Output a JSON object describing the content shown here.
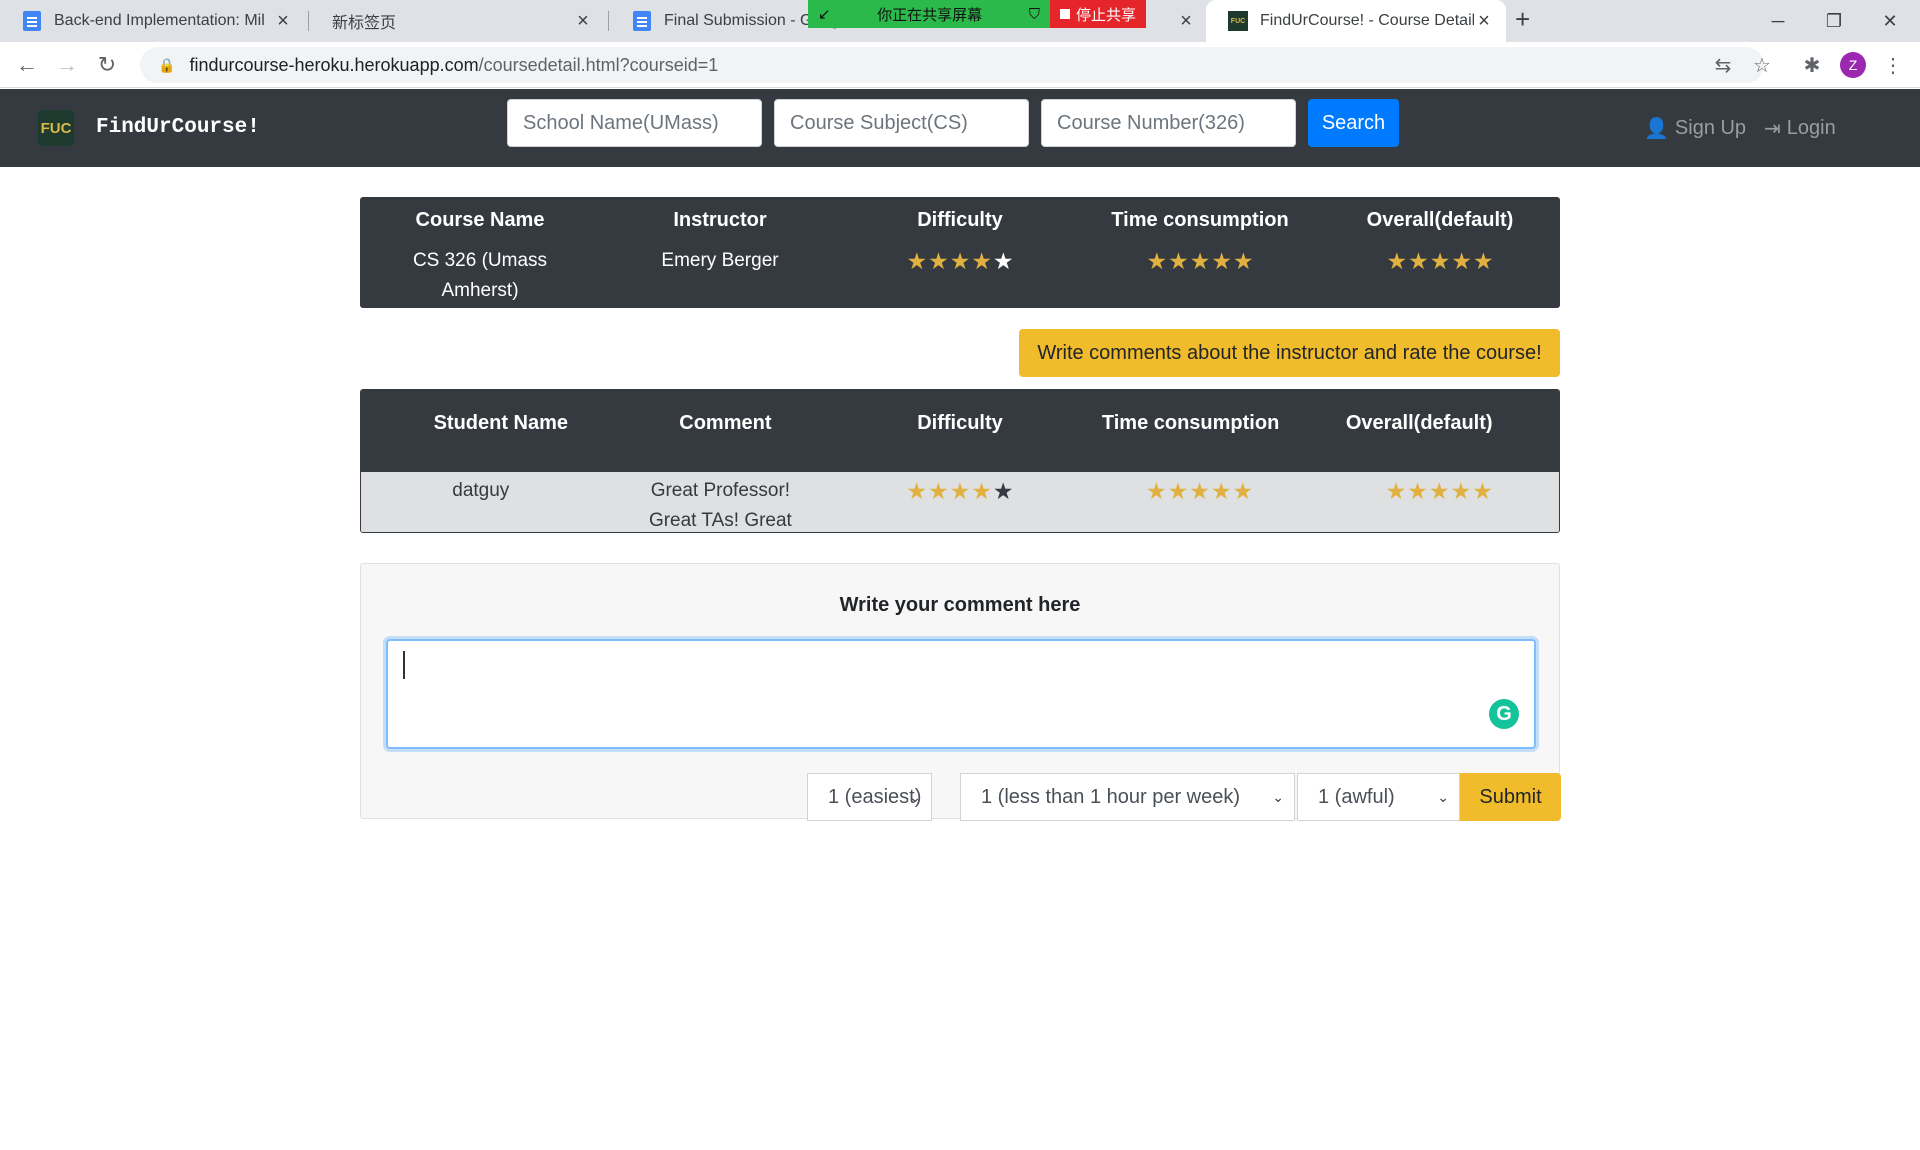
{
  "browser": {
    "tabs": [
      {
        "title": "Back-end Implementation: Mil",
        "icon": "docs-icon"
      },
      {
        "title": "新标签页",
        "icon": "none"
      },
      {
        "title": "Final Submission - Goog",
        "icon": "docs-icon"
      },
      {
        "title": "FindUrCourse! - Course Detail",
        "icon": "fuc-icon",
        "favicon_text": "FUC"
      }
    ],
    "share_banner": {
      "sharing_text": "你正在共享屏幕",
      "stop_text": "停止共享"
    },
    "url_host": "findurcourse-heroku.herokuapp.com",
    "url_path": "/coursedetail.html?courseid=1",
    "profile_initial": "Z"
  },
  "navbar": {
    "logo_text": "FUC",
    "brand": "FindUrCourse!",
    "search": {
      "school_placeholder": "School Name(UMass)",
      "subject_placeholder": "Course Subject(CS)",
      "number_placeholder": "Course Number(326)",
      "button": "Search"
    },
    "signup": "Sign Up",
    "login": "Login"
  },
  "course": {
    "headers": [
      "Course Name",
      "Instructor",
      "Difficulty",
      "Time consumption",
      "Overall(default)"
    ],
    "name": "CS 326 (Umass Amherst)",
    "instructor": "Emery Berger",
    "difficulty_stars": 4,
    "time_stars": 5,
    "overall_stars": 5
  },
  "write_button": "Write comments about the instructor and rate the course!",
  "comments": {
    "headers": [
      "Student Name",
      "Comment",
      "Difficulty",
      "Time consumption",
      "Overall(default)"
    ],
    "rows": [
      {
        "student": "datguy",
        "comment": "Great Professor! Great TAs! Great Materials!",
        "difficulty_stars": 4,
        "time_stars": 5,
        "overall_stars": 5
      }
    ]
  },
  "comment_form": {
    "title": "Write your comment here",
    "textarea_value": "",
    "difficulty_selected": "1 (easiest)",
    "time_selected": "1 (less than 1 hour per week)",
    "overall_selected": "1 (awful)",
    "submit": "Submit"
  },
  "colors": {
    "navbar": "#343a40",
    "accent_yellow": "#f0bc2c",
    "search_blue": "#007bff",
    "star_gold": "#e0b040"
  }
}
